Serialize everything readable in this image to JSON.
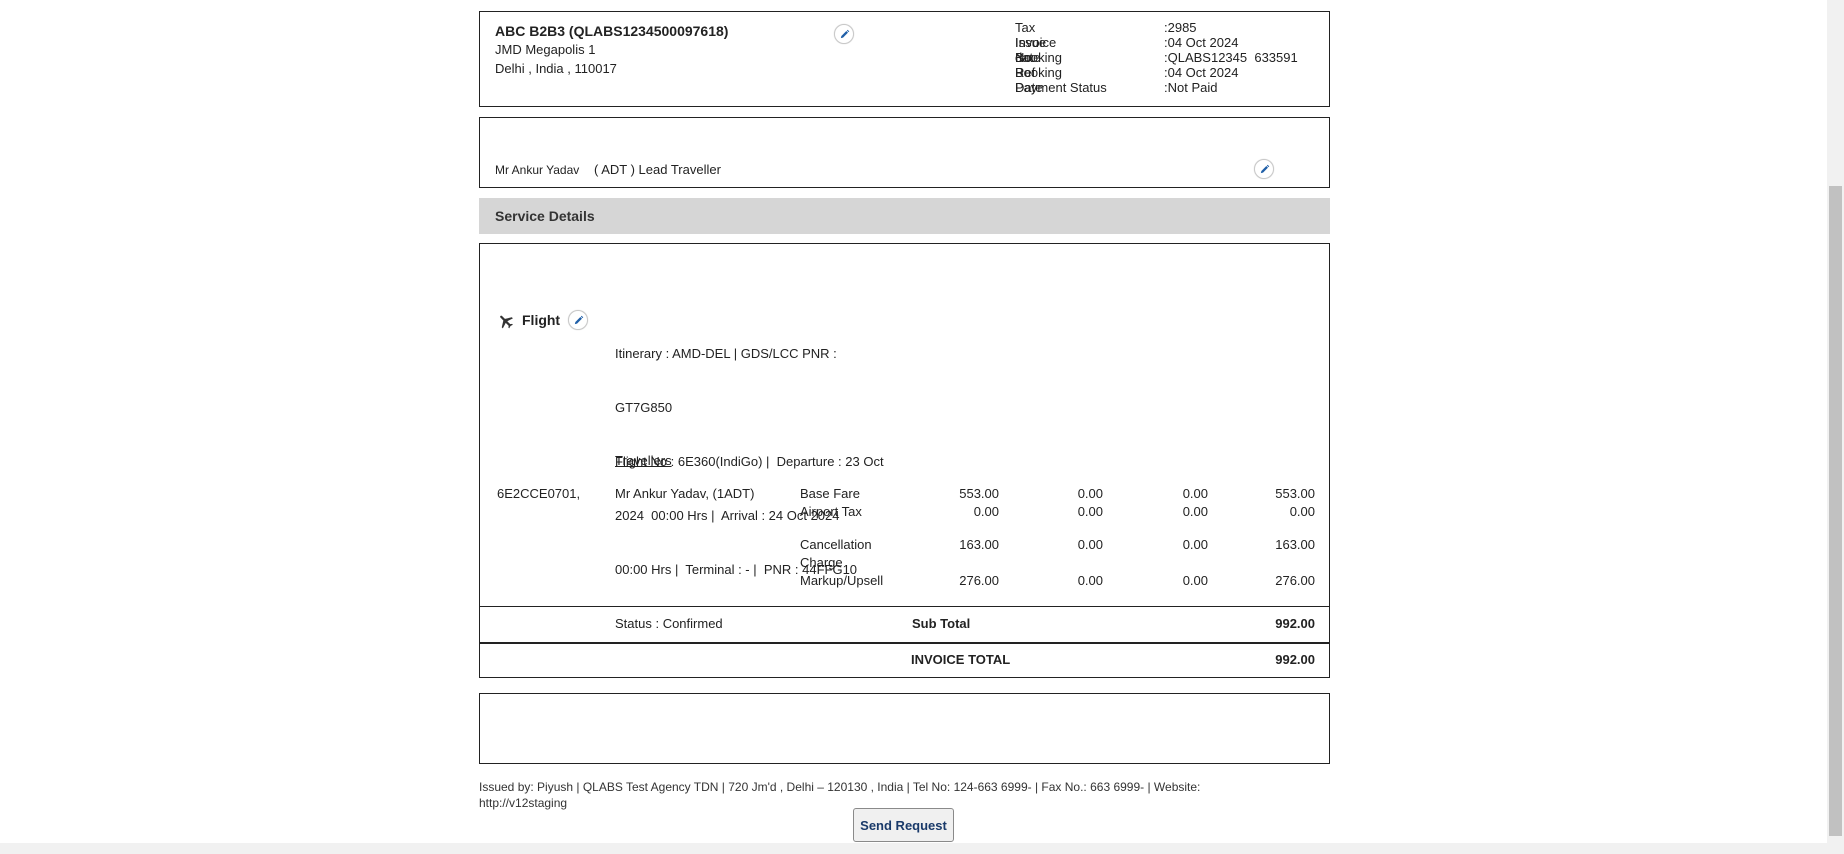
{
  "agency": {
    "name": "ABC B2B3 (QLABS1234500097618)",
    "address_line1": "JMD Megapolis 1",
    "address_line2": "Delhi ,  India ,  110017"
  },
  "invoice_meta": [
    {
      "label": "Tax Invoice No.",
      "value": ":2985"
    },
    {
      "label": "Issue date",
      "value": ":04 Oct 2024"
    },
    {
      "label": "Booking Ref",
      "value": ":QLABS12345  633591"
    },
    {
      "label": "Booking Date",
      "value": ":04 Oct 2024"
    },
    {
      "label": "Payment Status",
      "value": ":Not Paid"
    }
  ],
  "lead_traveller": {
    "name": "Mr Ankur Yadav",
    "type": "( ADT ) Lead Traveller"
  },
  "service_details_title": "Service Details",
  "flight": {
    "label": "Flight",
    "details_lines": [
      "Itinerary : AMD-DEL | GDS/LCC PNR :",
      "GT7G850",
      "Flight No : 6E360(IndiGo) |  Departure : 23 Oct",
      "2024  00:00 Hrs |  Arrival : 24 Oct 2024",
      "00:00 Hrs |  Terminal : - |  PNR : 44FFG10",
      "Status : Confirmed"
    ],
    "travellers_heading": "Travellers",
    "ticket_no": "6E2CCE0701,",
    "traveller_name": "Mr Ankur Yadav, (1ADT)",
    "charges": [
      {
        "label_lines": [
          "Base Fare"
        ],
        "c1": "553.00",
        "c2": "0.00",
        "c3": "0.00",
        "c4": "553.00"
      },
      {
        "label_lines": [
          "Airport Tax"
        ],
        "c1": "0.00",
        "c2": "0.00",
        "c3": "0.00",
        "c4": "0.00"
      },
      {
        "label_lines": [
          "Cancellation",
          "Charge"
        ],
        "c1": "163.00",
        "c2": "0.00",
        "c3": "0.00",
        "c4": "163.00"
      },
      {
        "label_lines": [
          "Markup/Upsell"
        ],
        "c1": "276.00",
        "c2": "0.00",
        "c3": "0.00",
        "c4": "276.00"
      }
    ]
  },
  "totals": {
    "subtotal_label": "Sub Total",
    "subtotal_value": "992.00",
    "invoice_total_label": "INVOICE TOTAL",
    "invoice_total_value": "992.00"
  },
  "footer": {
    "issued_by_line1": "Issued by: Piyush | QLABS Test Agency TDN | 720 Jm'd , Delhi – 120130 ,  India | Tel No: 124-663 6999- | Fax No.: 663 6999- | Website:",
    "issued_by_line2": "http://v12staging"
  },
  "send_request_label": "Send Request",
  "icons": {
    "edit": "pencil-icon",
    "flight": "airplane-icon"
  },
  "colors": {
    "edit_icon": "#1f5fa8",
    "section_header_bg": "#d6d6d6",
    "send_button_text": "#1a3a6a"
  }
}
